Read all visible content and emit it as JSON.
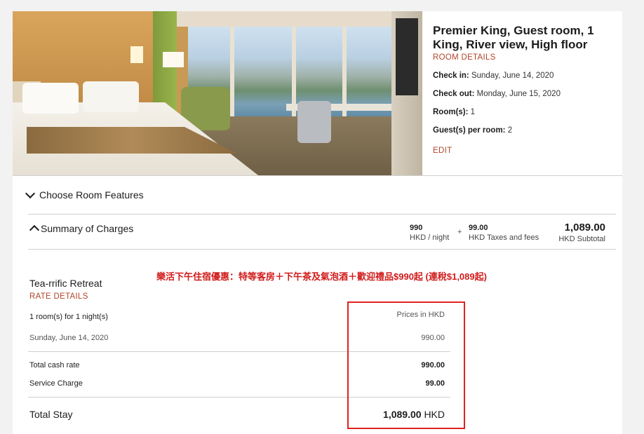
{
  "room": {
    "title": "Premier King, Guest room, 1 King, River view, High floor",
    "details_link": "ROOM DETAILS",
    "check_in_label": "Check in:",
    "check_in_value": "Sunday, June 14, 2020",
    "check_out_label": "Check out:",
    "check_out_value": "Monday, June 15, 2020",
    "rooms_label": "Room(s):",
    "rooms_value": "1",
    "guests_label": "Guest(s) per room:",
    "guests_value": "2",
    "edit_link": "EDIT"
  },
  "sections": {
    "choose_features": "Choose Room Features",
    "summary_of_charges": "Summary of Charges"
  },
  "charges": {
    "nightly_amount": "990",
    "nightly_unit": "HKD / night",
    "taxes_amount": "99.00",
    "taxes_label": "HKD Taxes and fees",
    "plus_sign": "+",
    "subtotal_amount": "1,089.00",
    "subtotal_label": "HKD Subtotal"
  },
  "promo_text": "樂活下午住宿優惠：特等客房＋下午茶及氣泡酒＋歡迎禮品$990起 (連稅$1,089起)",
  "rate": {
    "name": "Tea-rrific Retreat",
    "details_link": "RATE DETAILS",
    "rooms_nights": "1 room(s) for 1 night(s)",
    "prices_in": "Prices in HKD",
    "date": "Sunday, June 14, 2020",
    "date_amount": "990.00",
    "total_cash_label": "Total cash rate",
    "total_cash_value": "990.00",
    "service_label": "Service Charge",
    "service_value": "99.00",
    "total_stay_label": "Total Stay",
    "total_stay_amount": "1,089.00",
    "total_stay_currency": "HKD"
  },
  "colors": {
    "link": "#b0452a",
    "annotation_red": "#e0221f",
    "promo_red": "#d11a1a"
  }
}
